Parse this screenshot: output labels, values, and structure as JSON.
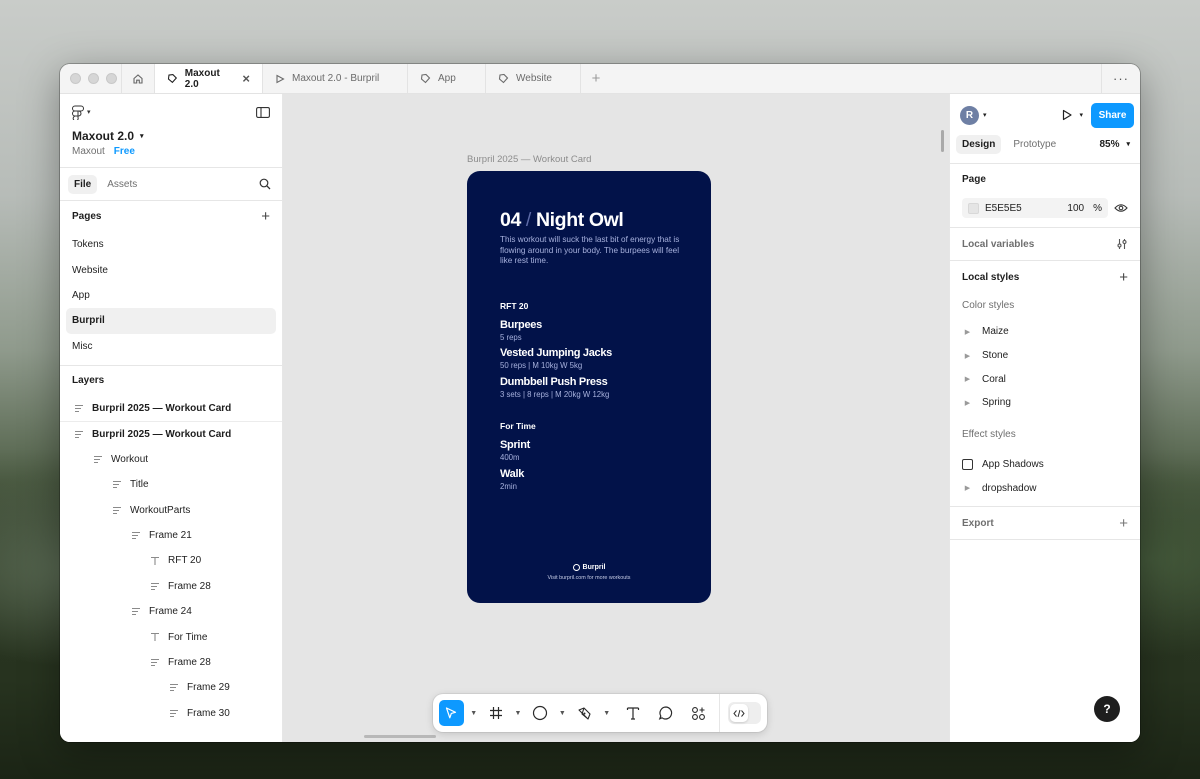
{
  "tabs": [
    {
      "label": "Maxout 2.0",
      "active": true
    },
    {
      "label": "Maxout 2.0 - Burpril",
      "active": false
    },
    {
      "label": "App",
      "active": false
    },
    {
      "label": "Website",
      "active": false
    }
  ],
  "file": {
    "name": "Maxout 2.0",
    "team": "Maxout",
    "plan": "Free"
  },
  "left_tabs": {
    "file": "File",
    "assets": "Assets"
  },
  "pages": {
    "heading": "Pages",
    "items": [
      "Tokens",
      "Website",
      "App",
      "Burpril",
      "Misc"
    ],
    "selected": "Burpril"
  },
  "layers": {
    "heading": "Layers",
    "items": [
      {
        "label": "Burpril 2025 — Workout Card",
        "type": "frame"
      },
      {
        "label": "Burpril 2025 — Workout Card",
        "type": "frame"
      },
      {
        "label": "Workout",
        "type": "frame"
      },
      {
        "label": "Title",
        "type": "frame"
      },
      {
        "label": "WorkoutParts",
        "type": "frame"
      },
      {
        "label": "Frame 21",
        "type": "frame"
      },
      {
        "label": "RFT 20",
        "type": "text"
      },
      {
        "label": "Frame 28",
        "type": "frame"
      },
      {
        "label": "Frame 24",
        "type": "frame"
      },
      {
        "label": "For Time",
        "type": "text"
      },
      {
        "label": "Frame 28",
        "type": "frame"
      },
      {
        "label": "Frame 29",
        "type": "frame"
      },
      {
        "label": "Frame 30",
        "type": "frame"
      }
    ]
  },
  "canvas": {
    "frame_label": "Burpril 2025 — Workout Card",
    "background": "#e5e5e5",
    "card": {
      "background": "#021249",
      "number": "04",
      "slash": "/",
      "title": "Night Owl",
      "description": "This workout will suck the last bit of energy that is flowing around in your body. The burpees will feel like rest time.",
      "section1": "RFT 20",
      "exercises1": [
        {
          "name": "Burpees",
          "detail": "5 reps"
        },
        {
          "name": "Vested Jumping Jacks",
          "detail": "50 reps | M 10kg W 5kg"
        },
        {
          "name": "Dumbbell Push Press",
          "detail": "3 sets | 8 reps | M 20kg W 12kg"
        }
      ],
      "section2": "For Time",
      "exercises2": [
        {
          "name": "Sprint",
          "detail": "400m"
        },
        {
          "name": "Walk",
          "detail": "2min"
        }
      ],
      "brand": "Burpril",
      "footer": "Visit burpril.com for more workouts"
    }
  },
  "toolbar": {
    "tools": [
      "move-tool",
      "frame-tool",
      "shape-tool",
      "pen-tool",
      "text-tool",
      "comment-tool",
      "actions-tool"
    ],
    "selected": "move-tool",
    "accent": "#0d99ff"
  },
  "right": {
    "avatar": "R",
    "share": "Share",
    "tabs": {
      "design": "Design",
      "prototype": "Prototype"
    },
    "zoom": "85%",
    "page_heading": "Page",
    "page_color": "E5E5E5",
    "page_opacity": "100",
    "percent": "%",
    "local_variables": "Local variables",
    "local_styles": "Local styles",
    "color_styles_heading": "Color styles",
    "color_styles": [
      "Maize",
      "Stone",
      "Coral",
      "Spring"
    ],
    "effect_styles_heading": "Effect styles",
    "effect_styles": [
      "App Shadows",
      "dropshadow"
    ],
    "export": "Export",
    "help": "?"
  }
}
